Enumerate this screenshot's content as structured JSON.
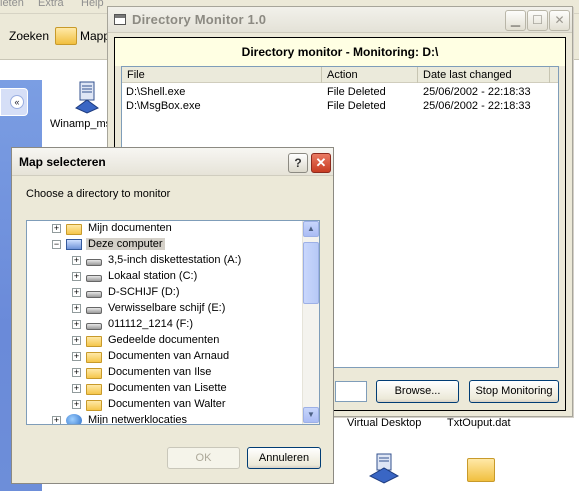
{
  "background": {
    "menu": [
      "ieten",
      "Extra",
      "Help"
    ],
    "toolbar": {
      "search_label": "Zoeken",
      "folders_label": "Mapp"
    },
    "items": [
      {
        "label": "Winamp_ms"
      },
      {
        "label": "Virtual Desktop"
      },
      {
        "label": "TxtOuput.dat"
      }
    ]
  },
  "dm": {
    "title": "Directory Monitor 1.0",
    "header": "Directory monitor - Monitoring: D:\\",
    "columns": [
      "File",
      "Action",
      "Date last changed"
    ],
    "rows": [
      {
        "file": "D:\\Shell.exe",
        "action": "File Deleted",
        "date": "25/06/2002 - 22:18:33"
      },
      {
        "file": "D:\\MsgBox.exe",
        "action": "File Deleted",
        "date": "25/06/2002 - 22:18:33"
      }
    ],
    "browse_label": "Browse...",
    "stop_label": "Stop Monitoring"
  },
  "map": {
    "title": "Map selecteren",
    "help_label": "?",
    "instruction": "Choose a directory to monitor",
    "tree": [
      {
        "label": "Mijn documenten",
        "icon": "folder-icon",
        "level": 1,
        "expander": "+"
      },
      {
        "label": "Deze computer",
        "icon": "computer-icon",
        "level": 1,
        "expander": "−",
        "selected": true
      },
      {
        "label": "3,5-inch diskettestation (A:)",
        "icon": "floppy-drive-icon",
        "level": 2,
        "expander": "+"
      },
      {
        "label": "Lokaal station (C:)",
        "icon": "hard-drive-icon",
        "level": 2,
        "expander": "+"
      },
      {
        "label": "D-SCHIJF (D:)",
        "icon": "hard-drive-icon",
        "level": 2,
        "expander": "+"
      },
      {
        "label": "Verwisselbare schijf (E:)",
        "icon": "removable-drive-icon",
        "level": 2,
        "expander": "+"
      },
      {
        "label": "011112_1214 (F:)",
        "icon": "cd-drive-icon",
        "level": 2,
        "expander": "+"
      },
      {
        "label": "Gedeelde documenten",
        "icon": "folder-icon",
        "level": 2,
        "expander": "+"
      },
      {
        "label": "Documenten van Arnaud",
        "icon": "folder-icon",
        "level": 2,
        "expander": "+"
      },
      {
        "label": "Documenten van Ilse",
        "icon": "folder-icon",
        "level": 2,
        "expander": "+"
      },
      {
        "label": "Documenten van Lisette",
        "icon": "folder-icon",
        "level": 2,
        "expander": "+"
      },
      {
        "label": "Documenten van Walter",
        "icon": "folder-icon",
        "level": 2,
        "expander": "+"
      },
      {
        "label": "Mijn netwerklocaties",
        "icon": "network-icon",
        "level": 1,
        "expander": "+"
      }
    ],
    "ok_label": "OK",
    "cancel_label": "Annuleren"
  }
}
